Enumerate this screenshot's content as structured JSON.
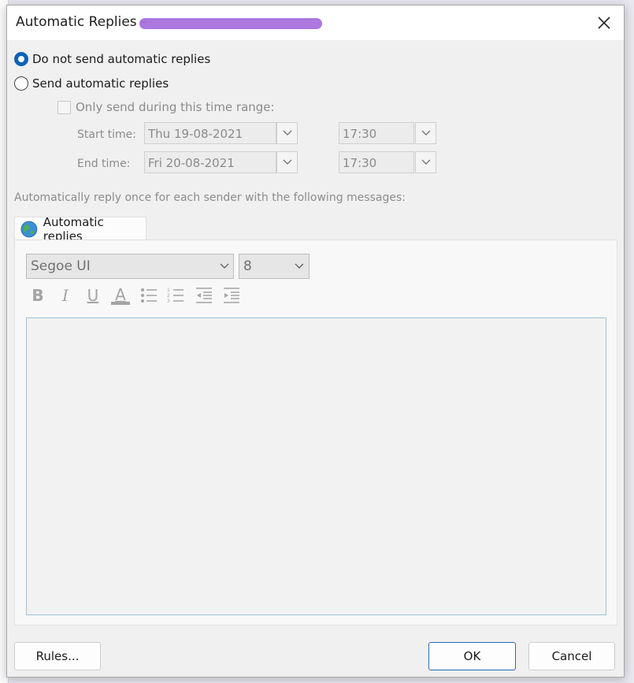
{
  "dialog": {
    "title": "Automatic Replies - ",
    "close_icon": "close-icon"
  },
  "options": {
    "do_not_send": "Do not send automatic replies",
    "send": "Send automatic replies",
    "selected": "do_not_send"
  },
  "time_range": {
    "checkbox_label": "Only send during this time range:",
    "start_label": "Start time:",
    "start_date": "Thu 19-08-2021",
    "start_time": "17:30",
    "end_label": "End time:",
    "end_date": "Fri 20-08-2021",
    "end_time": "17:30"
  },
  "hint": "Automatically reply once for each sender with the following messages:",
  "tab": {
    "label": "Automatic replies",
    "icon": "globe-icon"
  },
  "formatting": {
    "font": "Segoe UI",
    "size": "8",
    "bold": "B",
    "italic": "I",
    "underline": "U",
    "font_color": "A"
  },
  "buttons": {
    "rules": "Rules...",
    "ok": "OK",
    "cancel": "Cancel"
  },
  "colors": {
    "accent": "#0f62b4",
    "redaction": "#a56bdc"
  }
}
